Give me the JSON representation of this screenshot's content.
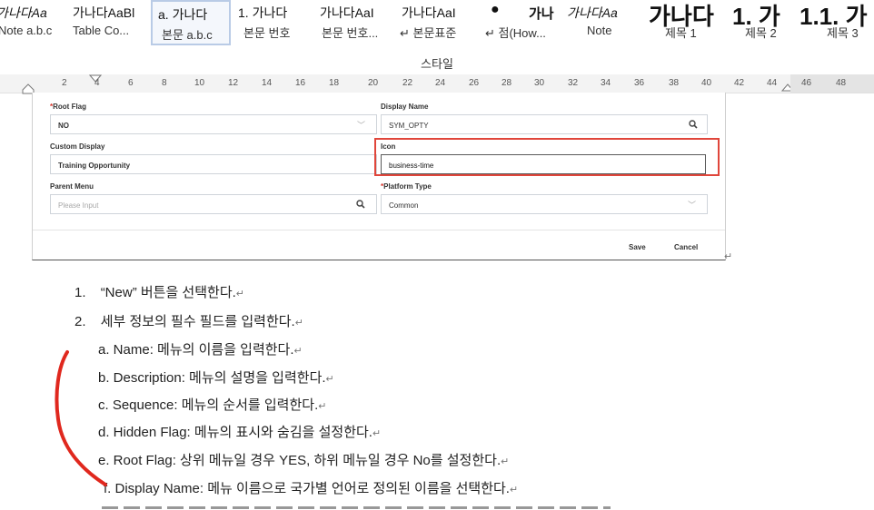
{
  "gallery": {
    "styles": [
      {
        "preview": "가나다Aa",
        "name": "Note a.b.c"
      },
      {
        "preview": "가나다AaBl",
        "name": "Table Co..."
      },
      {
        "preview": "a. 가나다",
        "name": "본문 a.b.c"
      },
      {
        "preview": "1. 가나다",
        "name": "본문 번호"
      },
      {
        "preview": "가나다AaI",
        "name": "본문 번호..."
      },
      {
        "preview": "가나다AaI",
        "name": "↵ 본문표준"
      },
      {
        "preview": "●",
        "name": "↵ 점(How..."
      },
      {
        "preview": "가나",
        "name": "Note"
      },
      {
        "preview": "가나다Aa",
        "name": "제목 1"
      },
      {
        "preview": "가나다",
        "name": "제목 2"
      },
      {
        "preview": "1. 가",
        "name": "제목 3"
      },
      {
        "preview": "1.1. 가",
        "name": ""
      }
    ],
    "group_label": "스타일"
  },
  "ruler": {
    "numbers": [
      "2",
      "4",
      "6",
      "8",
      "10",
      "12",
      "14",
      "16",
      "18",
      "20",
      "22",
      "24",
      "26",
      "28",
      "30",
      "32",
      "34",
      "36",
      "38",
      "40",
      "42",
      "44",
      "46",
      "48"
    ]
  },
  "form": {
    "root_flag": {
      "label": "Root Flag",
      "required_mark": "*",
      "value": "NO"
    },
    "display_name": {
      "label": "Display Name",
      "value": "SYM_OPTY"
    },
    "custom_display": {
      "label": "Custom Display",
      "value": "Training Opportunity"
    },
    "icon": {
      "label": "Icon",
      "value": "business-time"
    },
    "parent_menu": {
      "label": "Parent Menu",
      "placeholder": "Please Input"
    },
    "platform_type": {
      "label": "Platform Type",
      "required_mark": "*",
      "value": "Common"
    },
    "save_label": "Save",
    "cancel_label": "Cancel",
    "highlight_color": "#e0463b"
  },
  "document": {
    "steps": [
      {
        "num": "1.",
        "text": "“New” 버튼을 선택한다."
      },
      {
        "num": "2.",
        "text": "세부 정보의 필수 필드를 입력한다."
      }
    ],
    "substeps": [
      "a. Name: 메뉴의 이름을 입력한다.",
      "b. Description: 메뉴의 설명을 입력한다.",
      "c. Sequence: 메뉴의 순서를 입력한다.",
      "d. Hidden Flag: 메뉴의 표시와 숨김을 설정한다.",
      "e. Root Flag: 상위 메뉴일 경우 YES, 하위 메뉴일 경우 No를 설정한다.",
      "f. Display Name: 메뉴 이름으로 국가별 언어로 정의된 이름을 선택한다."
    ],
    "return_mark": "↵",
    "annotation_color": "#e0281e"
  }
}
